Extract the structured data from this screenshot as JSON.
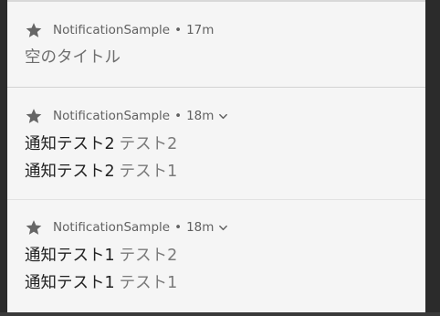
{
  "notifications": [
    {
      "app_name": "NotificationSample",
      "separator": "•",
      "time": "17m",
      "expandable": false,
      "lines": [
        {
          "title": "空のタイトル",
          "text": ""
        }
      ]
    },
    {
      "app_name": "NotificationSample",
      "separator": "•",
      "time": "18m",
      "expandable": true,
      "lines": [
        {
          "title": "通知テスト2",
          "text": "テスト2"
        },
        {
          "title": "通知テスト2",
          "text": "テスト1"
        }
      ]
    },
    {
      "app_name": "NotificationSample",
      "separator": "•",
      "time": "18m",
      "expandable": true,
      "lines": [
        {
          "title": "通知テスト1",
          "text": "テスト2"
        },
        {
          "title": "通知テスト1",
          "text": "テスト1"
        }
      ]
    }
  ],
  "icons": {
    "app_icon": "star-icon",
    "expand_icon": "chevron-down-icon"
  },
  "colors": {
    "background": "#f5f5f5",
    "header_text": "#616161",
    "title_text": "#212121",
    "body_text": "#7a7a7a",
    "divider": "#d2d2d2"
  }
}
